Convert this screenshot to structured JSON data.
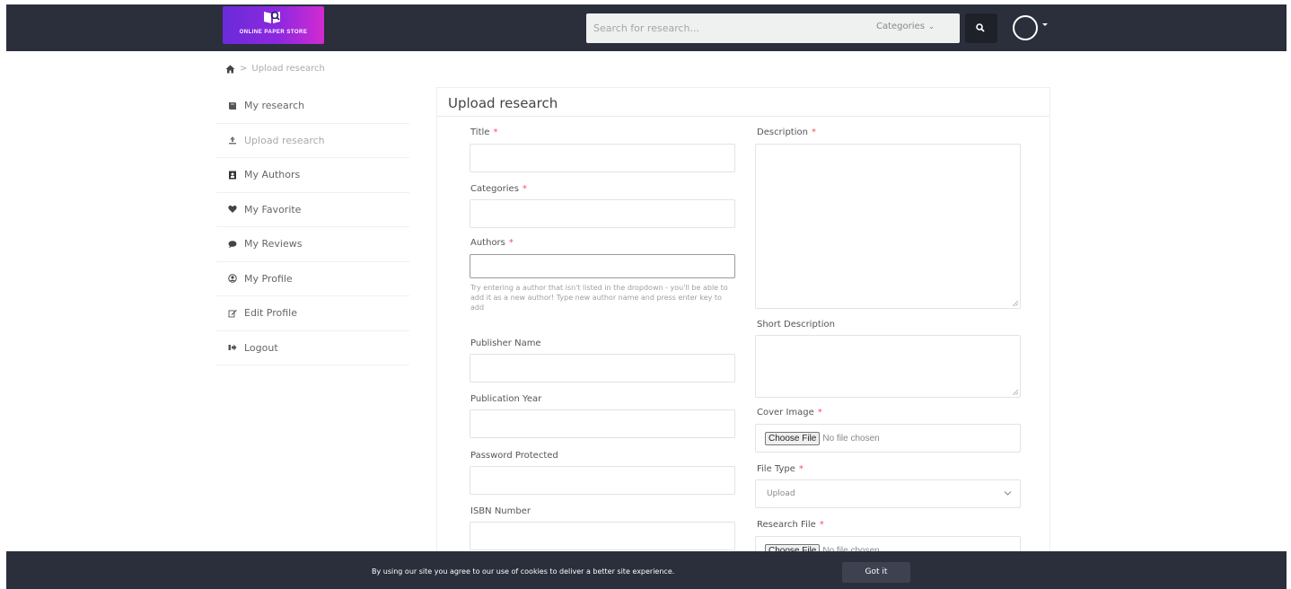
{
  "header": {
    "logo_text": "ONLINE PAPER STORE",
    "search_placeholder": "Search for research...",
    "categories_label": "Categories",
    "search_icon": "search-icon",
    "avatar_icon": "user-avatar"
  },
  "breadcrumb": {
    "home_icon": "home-icon",
    "separator": ">",
    "current": "Upload research"
  },
  "sidebar": {
    "items": [
      {
        "label": "My research",
        "icon": "book-icon",
        "active": false
      },
      {
        "label": "Upload research",
        "icon": "upload-icon",
        "active": true
      },
      {
        "label": "My Authors",
        "icon": "address-book-icon",
        "active": false
      },
      {
        "label": "My Favorite",
        "icon": "heart-icon",
        "active": false
      },
      {
        "label": "My Reviews",
        "icon": "comment-icon",
        "active": false
      },
      {
        "label": "My Profile",
        "icon": "user-circle-icon",
        "active": false
      },
      {
        "label": "Edit Profile",
        "icon": "edit-icon",
        "active": false
      },
      {
        "label": "Logout",
        "icon": "sign-out-icon",
        "active": false
      }
    ]
  },
  "form": {
    "title": "Upload research",
    "required_mark": "*",
    "fields": {
      "title": {
        "label": "Title",
        "value": ""
      },
      "categories": {
        "label": "Categories",
        "value": ""
      },
      "authors": {
        "label": "Authors",
        "value": "",
        "hint": "Try entering a author that isn't listed in the dropdown - you'll be able to add it as a new author! Type new author name and press enter key to add"
      },
      "publisher": {
        "label": "Publisher Name",
        "value": ""
      },
      "publication_year": {
        "label": "Publication Year",
        "value": ""
      },
      "password": {
        "label": "Password Protected",
        "value": ""
      },
      "isbn": {
        "label": "ISBN Number",
        "value": ""
      },
      "description": {
        "label": "Description",
        "value": ""
      },
      "short_description": {
        "label": "Short Description",
        "value": ""
      },
      "cover_image": {
        "label": "Cover Image",
        "button": "Choose File",
        "status": "No file chosen"
      },
      "file_type": {
        "label": "File Type",
        "value": "Upload"
      },
      "research_file": {
        "label": "Research File",
        "button": "Choose File",
        "status": "No file chosen"
      }
    }
  },
  "cookie": {
    "text": "By using our site you agree to our use of cookies to deliver a better site experience.",
    "button": "Got it"
  },
  "colors": {
    "nav_bg": "#2b2e3b",
    "required": "#ff4b5c",
    "logo_gradient_start": "#6a2bd8",
    "logo_gradient_end": "#d12bd0"
  }
}
